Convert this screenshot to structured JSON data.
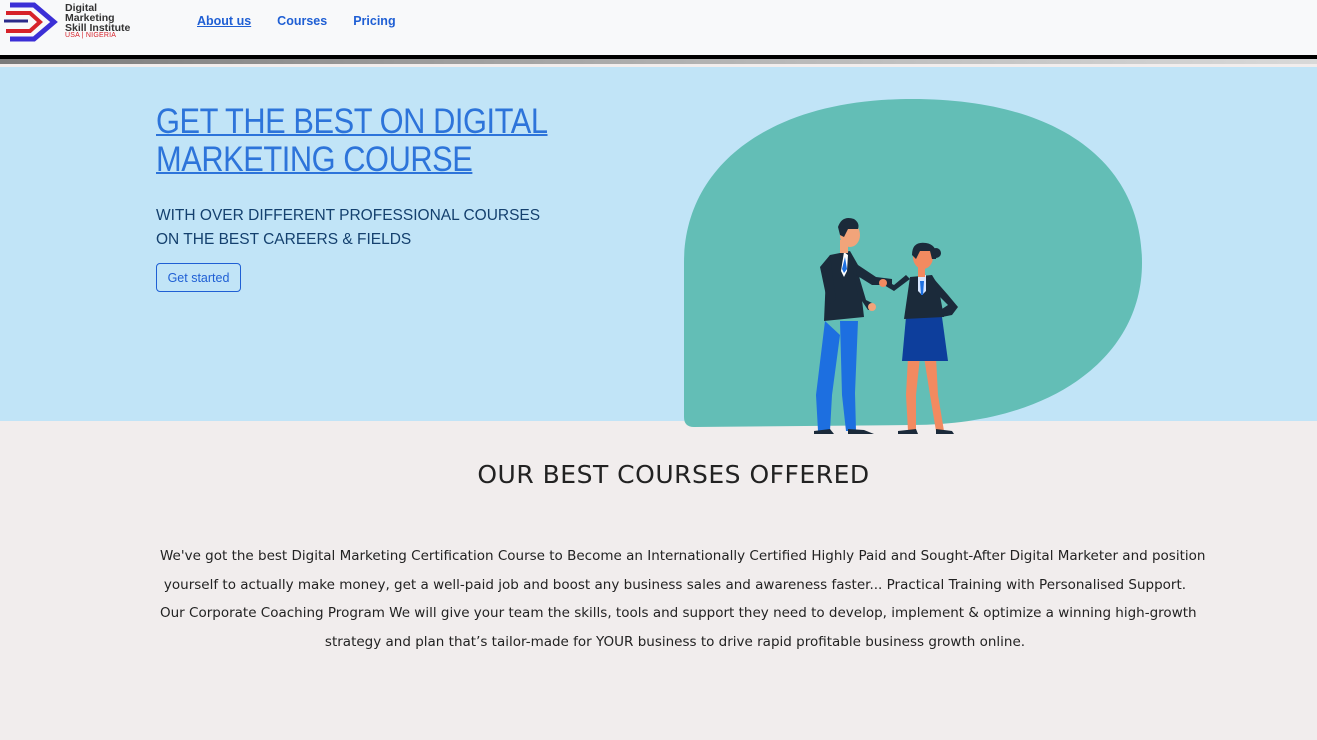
{
  "brand": {
    "name_lines": [
      "Digital",
      "Marketing",
      "Skill Institute"
    ],
    "tagline": "USA | NIGERIA"
  },
  "nav": {
    "items": [
      {
        "label": "About us",
        "active": true
      },
      {
        "label": "Courses",
        "active": false
      },
      {
        "label": "Pricing",
        "active": false
      }
    ]
  },
  "hero": {
    "title": "GET THE BEST ON DIGITAL MARKETING COURSE",
    "subtitle_lines": [
      "WITH OVER DIFFERENT PROFESSIONAL COURSES",
      "ON THE BEST CAREERS & FIELDS"
    ],
    "cta_label": "Get started",
    "illustration": "handshake-illustration"
  },
  "courses": {
    "heading": "OUR BEST COURSES OFFERED",
    "description_lines": [
      "We've got the best Digital Marketing Certification Course to Become an Internationally Certified Highly Paid and Sought-After Digital Marketer and position",
      "yourself to actually make money, get a well-paid job and boost any business sales and awareness faster... Practical Training with Personalised Support.",
      "Our Corporate Coaching Program We will give your team the skills, tools and support they need to develop, implement & optimize a winning high-growth",
      "strategy and plan that’s tailor-made for YOUR business to drive rapid profitable business growth online."
    ]
  },
  "colors": {
    "accent": "#2d74da",
    "hero_bg": "#c1e4f7",
    "blob": "#63beb6",
    "page_bg": "#f1eded"
  }
}
